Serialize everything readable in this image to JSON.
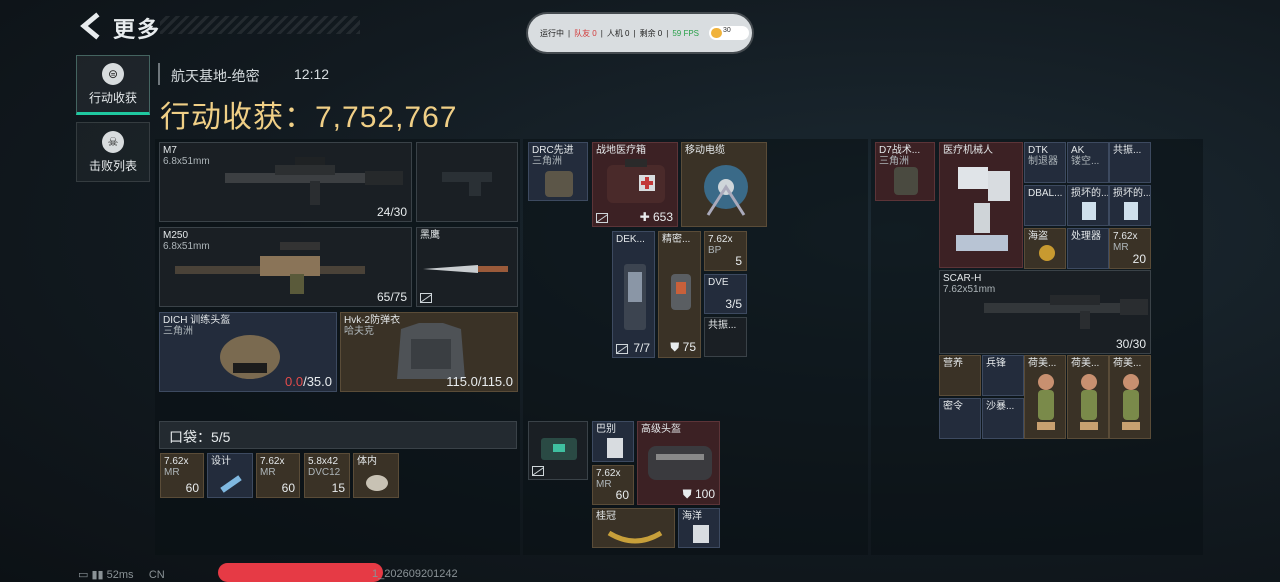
{
  "header": {
    "title": "更多",
    "back_icon": "chevron-left-icon"
  },
  "status": {
    "running": "运行中",
    "teammates": "队友 0",
    "ai": "人机 0",
    "remaining": "剩余 0",
    "fps": "59 FPS",
    "battery": "30"
  },
  "tabs": [
    {
      "label": "行动收获",
      "icon": "harvest-icon",
      "active": true
    },
    {
      "label": "击败列表",
      "icon": "skull-icon",
      "active": false
    }
  ],
  "info": {
    "map": "航天基地-绝密",
    "time": "12:12",
    "harvest_label": "行动收获：",
    "harvest_value": "7,752,767"
  },
  "loadout": {
    "m7": {
      "name": "M7",
      "ammo": "6.8x51mm",
      "value": "24/30"
    },
    "m250": {
      "name": "M250",
      "ammo": "6.8x51mm",
      "value": "65/75"
    },
    "blackhawk": {
      "name": "黑鹰"
    },
    "helmet": {
      "name": "DICH 训练头盔",
      "sub": "三角洲",
      "dur_now": "0.0",
      "dur_max": "/35.0"
    },
    "armor": {
      "name": "Hvk-2防弹衣",
      "sub": "哈夫克",
      "value": "115.0/115.0"
    },
    "pocket": {
      "label": "口袋：",
      "count": "5/5"
    },
    "pocket_items": [
      {
        "name": "7.62x",
        "sub": "MR",
        "value": "60"
      },
      {
        "name": "设计",
        "sub": "",
        "value": ""
      },
      {
        "name": "7.62x",
        "sub": "MR",
        "value": "60"
      },
      {
        "name": "5.8x42",
        "sub": "DVC12",
        "value": "15"
      },
      {
        "name": "体内",
        "sub": "",
        "value": ""
      }
    ]
  },
  "backpack": {
    "drc": {
      "name": "DRC先进",
      "sub": "三角洲"
    },
    "medkit": {
      "name": "战地医疗箱",
      "value": "653"
    },
    "reel": {
      "name": "移动电缆"
    },
    "dek": {
      "name": "DEK...",
      "value": "7/7"
    },
    "precision": {
      "name": "精密...",
      "value": "75"
    },
    "ammo762": {
      "name": "7.62x",
      "sub": "BP",
      "value": "5"
    },
    "dve": {
      "name": "DVE",
      "value": "3/5"
    },
    "resonance": {
      "name": "共振..."
    },
    "bar": {
      "name": "巴别"
    },
    "helmet2": {
      "name": "高级头盔",
      "value": "100"
    },
    "ammo762b": {
      "name": "7.62x",
      "sub": "MR",
      "value": "60"
    },
    "laurel": {
      "name": "桂冠"
    },
    "haiyang": {
      "name": "海洋"
    }
  },
  "rig": {
    "d7": {
      "name": "D7战术...",
      "sub": "三角洲"
    },
    "robot": {
      "name": "医疗机械人"
    },
    "dtk": {
      "name": "DTK",
      "sub": "制退器"
    },
    "ak": {
      "name": "AK",
      "sub": "镂空..."
    },
    "gongzhen": {
      "name": "共振..."
    },
    "dbal": {
      "name": "DBAL..."
    },
    "damaged1": {
      "name": "损坏的..."
    },
    "damaged2": {
      "name": "损坏的..."
    },
    "haidao": {
      "name": "海盗"
    },
    "processor": {
      "name": "处理器"
    },
    "ammo762": {
      "name": "7.62x",
      "sub": "MR",
      "value": "20"
    },
    "scar": {
      "name": "SCAR-H",
      "ammo": "7.62x51mm",
      "value": "30/30"
    },
    "yingmei": {
      "name": "营养"
    },
    "bingfeng": {
      "name": "兵锋"
    },
    "hemei1": {
      "name": "荷美..."
    },
    "hemei2": {
      "name": "荷美..."
    },
    "hemei3": {
      "name": "荷美..."
    },
    "miling": {
      "name": "密令"
    },
    "shabao": {
      "name": "沙暴..."
    }
  },
  "footer": {
    "ping": "52ms",
    "region": "CN",
    "code": "1_202609201242"
  },
  "colors": {
    "gold": "#f0cf86",
    "accent": "#1fc8a0",
    "low_durability": "#e34b4b"
  }
}
